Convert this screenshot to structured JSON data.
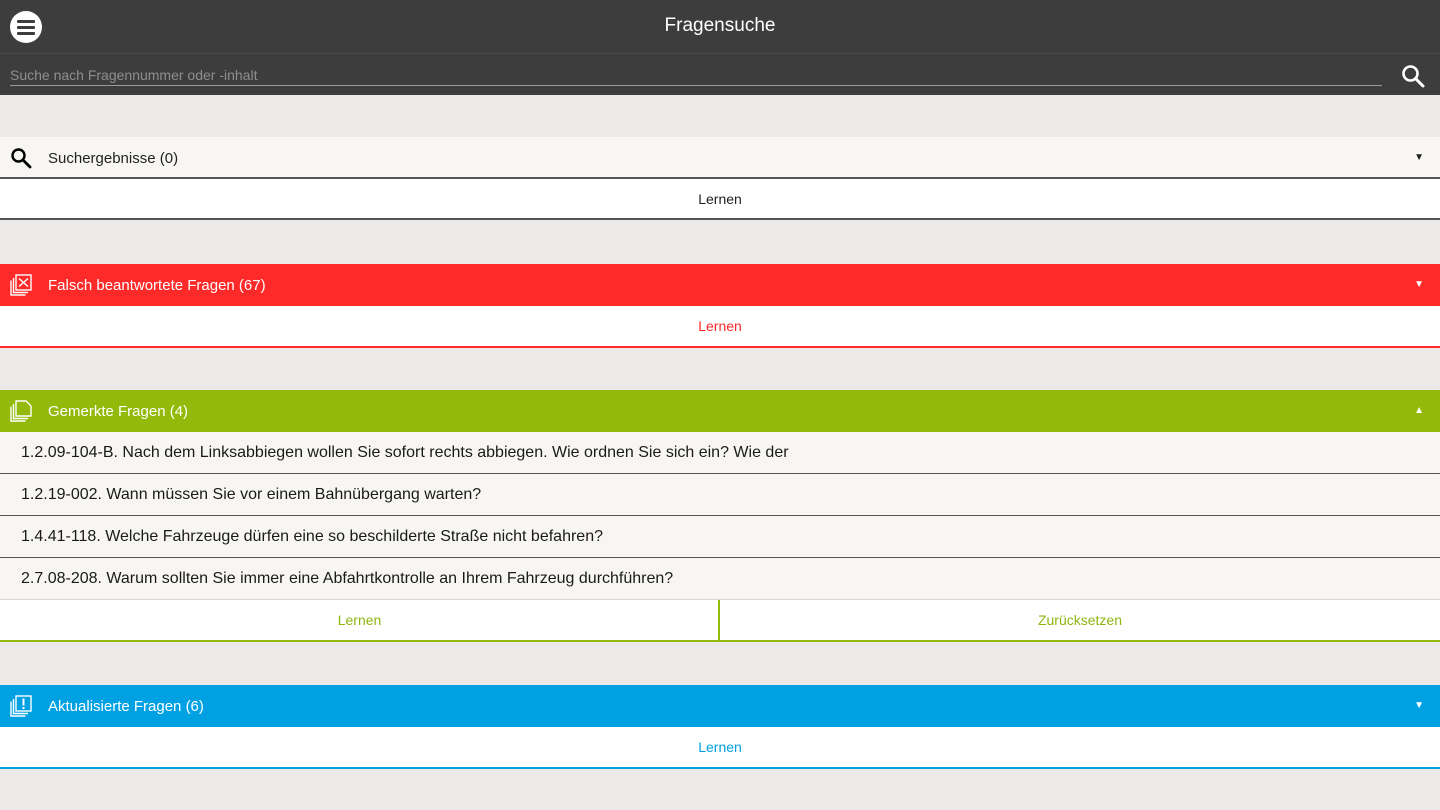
{
  "header": {
    "title": "Fragensuche"
  },
  "search": {
    "placeholder": "Suche nach Fragennummer oder -inhalt",
    "value": ""
  },
  "sections": {
    "results": {
      "label": "Suchergebnisse (0)",
      "learn": "Lernen"
    },
    "wrong": {
      "label": "Falsch beantwortete Fragen (67)",
      "learn": "Lernen"
    },
    "marked": {
      "label": "Gemerkte Fragen (4)",
      "questions": [
        "1.2.09-104-B. Nach dem Linksabbiegen wollen Sie sofort rechts abbiegen.  Wie ordnen Sie sich ein?    Wie der",
        "1.2.19-002. Wann müssen Sie vor einem Bahnübergang warten?",
        "1.4.41-118. Welche Fahrzeuge dürfen eine so beschilderte Straße nicht befahren?",
        "2.7.08-208. Warum sollten Sie immer eine Abfahrtkontrolle an Ihrem Fahrzeug durchführen?"
      ],
      "learn": "Lernen",
      "reset": "Zurücksetzen"
    },
    "updated": {
      "label": "Aktualisierte Fragen (6)",
      "learn": "Lernen"
    }
  },
  "colors": {
    "topbar": "#3d3d3d",
    "wrong": "#fe2929",
    "marked": "#93ba0a",
    "updated": "#00a1e3",
    "background": "#ebeae8"
  },
  "icons": {
    "menu": "menu-icon",
    "search": "search-icon",
    "wrong": "wrong-questions-icon",
    "marked": "marked-questions-icon",
    "updated": "updated-questions-icon"
  }
}
